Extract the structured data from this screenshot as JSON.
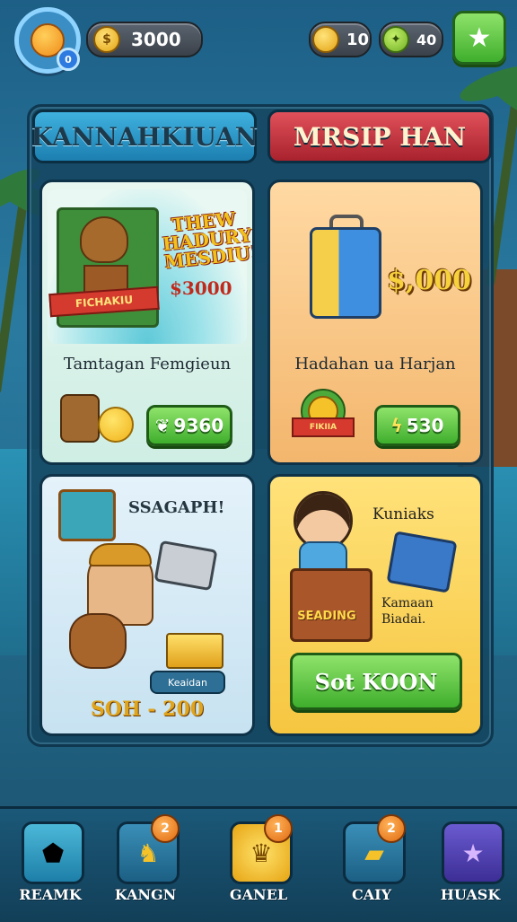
{
  "top_bar": {
    "player_badge": "0",
    "gold_pill": {
      "icon": "dollar-coin-icon",
      "value": "3000"
    },
    "coins": {
      "icon": "gold-coin-icon",
      "value": "10"
    },
    "gems": {
      "icon": "green-gem-icon",
      "value": "40"
    },
    "star_button_icon": "star-icon"
  },
  "tabs": [
    {
      "label": "KANNAHKIUAN"
    },
    {
      "label": "MRSIP HAN"
    }
  ],
  "cards": {
    "card1": {
      "headline": "THEW HADURY MESDIU!",
      "ribbon": "FICHAKIU",
      "scene_price": "$3000",
      "title": "Tamtagan Femgieun",
      "button_label": "9360"
    },
    "card2": {
      "price": "$,000",
      "title": "Hadahan ua Harjan",
      "badge_label": "FIKIIA",
      "button_label": "530"
    },
    "card3": {
      "title": "SSAGAPH!",
      "tag": "Keaidan",
      "range": "SOH - 200"
    },
    "card4": {
      "name": "Kuniaks",
      "box_label": "SEADING",
      "desc_line1": "Kamaan",
      "desc_line2": "Biadai.",
      "button_label": "Sot KOON"
    }
  },
  "bottom_nav": [
    {
      "label": "REAMK",
      "icon": "house-gem-icon",
      "badge": ""
    },
    {
      "label": "KANGN",
      "icon": "treasure-bag-icon",
      "badge": "2"
    },
    {
      "label": "GANEL",
      "icon": "trophy-icon",
      "badge": "1"
    },
    {
      "label": "CAIY",
      "icon": "gold-bars-icon",
      "badge": "2"
    },
    {
      "label": "HUASK",
      "icon": "purple-star-icon",
      "badge": ""
    }
  ],
  "colors": {
    "accent_green": "#3fae2d",
    "tab_blue": "#1c7fb0",
    "tab_red": "#a8222d",
    "gold": "#f0b21a"
  }
}
